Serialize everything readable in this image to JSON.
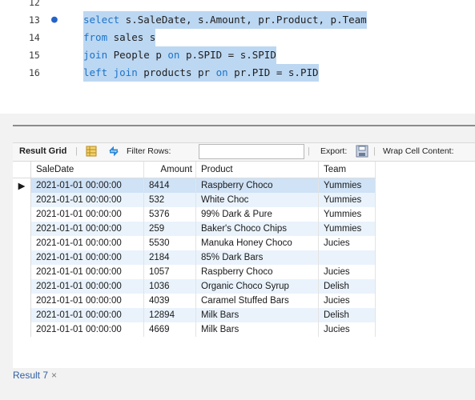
{
  "editor": {
    "lines": [
      {
        "num": "12",
        "marker": "",
        "code_parts": []
      },
      {
        "num": "13",
        "marker": "●",
        "code_parts": [
          {
            "t": "select",
            "kw": true
          },
          {
            "t": " s.SaleDate, s.Amount, pr.Product, p.Team",
            "kw": false
          }
        ]
      },
      {
        "num": "14",
        "marker": "",
        "code_parts": [
          {
            "t": "from",
            "kw": true
          },
          {
            "t": " sales s",
            "kw": false
          }
        ]
      },
      {
        "num": "15",
        "marker": "",
        "code_parts": [
          {
            "t": "join",
            "kw": true
          },
          {
            "t": " People p ",
            "kw": false
          },
          {
            "t": "on",
            "kw": true
          },
          {
            "t": " p.SPID = s.SPID",
            "kw": false
          }
        ]
      },
      {
        "num": "16",
        "marker": "",
        "code_parts": [
          {
            "t": "left join",
            "kw": true
          },
          {
            "t": " products pr ",
            "kw": false
          },
          {
            "t": "on",
            "kw": true
          },
          {
            "t": " pr.PID = s.PID",
            "kw": false
          }
        ]
      }
    ]
  },
  "toolbar": {
    "result_grid": "Result Grid",
    "filter_rows": "Filter Rows:",
    "export": "Export:",
    "wrap": "Wrap Cell Content:"
  },
  "grid": {
    "columns": [
      "SaleDate",
      "Amount",
      "Product",
      "Team"
    ],
    "rows": [
      [
        "2021-01-01 00:00:00",
        "8414",
        "Raspberry Choco",
        "Yummies"
      ],
      [
        "2021-01-01 00:00:00",
        "532",
        "White Choc",
        "Yummies"
      ],
      [
        "2021-01-01 00:00:00",
        "5376",
        "99% Dark & Pure",
        "Yummies"
      ],
      [
        "2021-01-01 00:00:00",
        "259",
        "Baker's Choco Chips",
        "Yummies"
      ],
      [
        "2021-01-01 00:00:00",
        "5530",
        "Manuka Honey Choco",
        "Jucies"
      ],
      [
        "2021-01-01 00:00:00",
        "2184",
        "85% Dark Bars",
        ""
      ],
      [
        "2021-01-01 00:00:00",
        "1057",
        "Raspberry Choco",
        "Jucies"
      ],
      [
        "2021-01-01 00:00:00",
        "1036",
        "Organic Choco Syrup",
        "Delish"
      ],
      [
        "2021-01-01 00:00:00",
        "4039",
        "Caramel Stuffed Bars",
        "Jucies"
      ],
      [
        "2021-01-01 00:00:00",
        "12894",
        "Milk Bars",
        "Delish"
      ],
      [
        "2021-01-01 00:00:00",
        "4669",
        "Milk Bars",
        "Jucies"
      ]
    ],
    "selected_marker": "▶"
  },
  "result_tab": {
    "label": "Result 7",
    "close": "×"
  }
}
